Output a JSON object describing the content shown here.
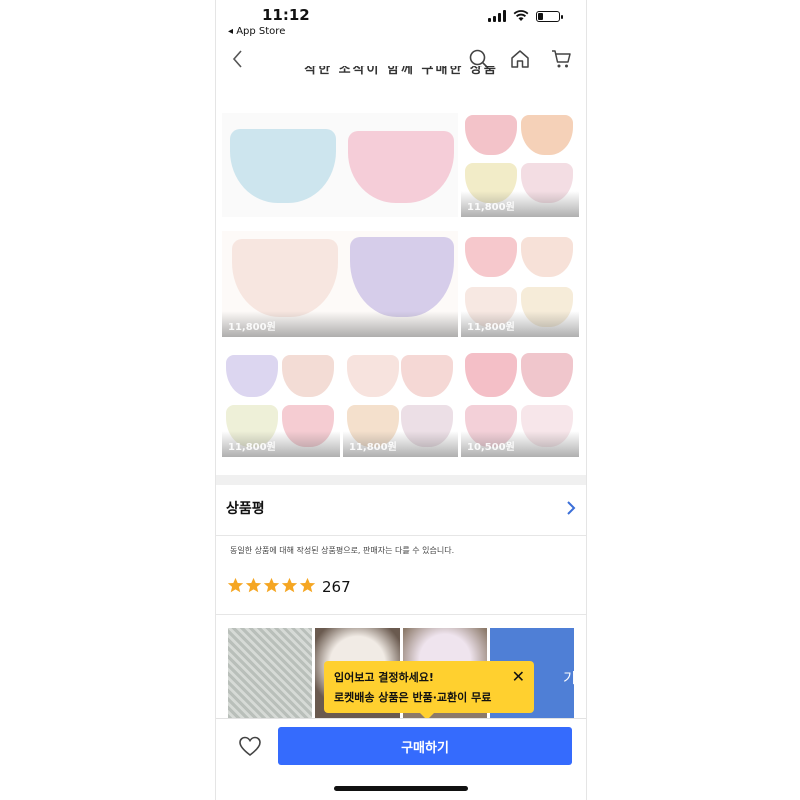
{
  "status_bar": {
    "time": "11:12",
    "back_app": "◂ App Store"
  },
  "nav": {
    "back_icon": "chevron-left-icon",
    "search_icon": "search-icon",
    "home_icon": "home-icon",
    "cart_icon": "cart-icon",
    "cut_off_subtitle": "착한 조작이 함께 구매한 상품"
  },
  "product_grid": {
    "cells": [
      {
        "price": "11,800원"
      },
      {
        "price": "11,800원"
      },
      {
        "price": "11,800원"
      },
      {
        "price": "11,800원"
      },
      {
        "price": "11,800원"
      },
      {
        "price": "10,500원"
      }
    ]
  },
  "reviews": {
    "title": "상품평",
    "note": "동일한 상품에 대해 작성된 상품평으로, 판매자는 다를 수 있습니다.",
    "rating_stars": 5,
    "count": "267",
    "photo_more": "기"
  },
  "tooltip": {
    "line1": "입어보고 결정하세요!",
    "line2": "로켓배송 상품은 반품·교환이 무료",
    "close": "✕"
  },
  "bottom_bar": {
    "buy_label": "구매하기",
    "wishlist_icon": "heart-icon"
  },
  "colors": {
    "buy_button": "#356bfd",
    "tooltip": "#ffd02f",
    "star": "#f5a623"
  }
}
